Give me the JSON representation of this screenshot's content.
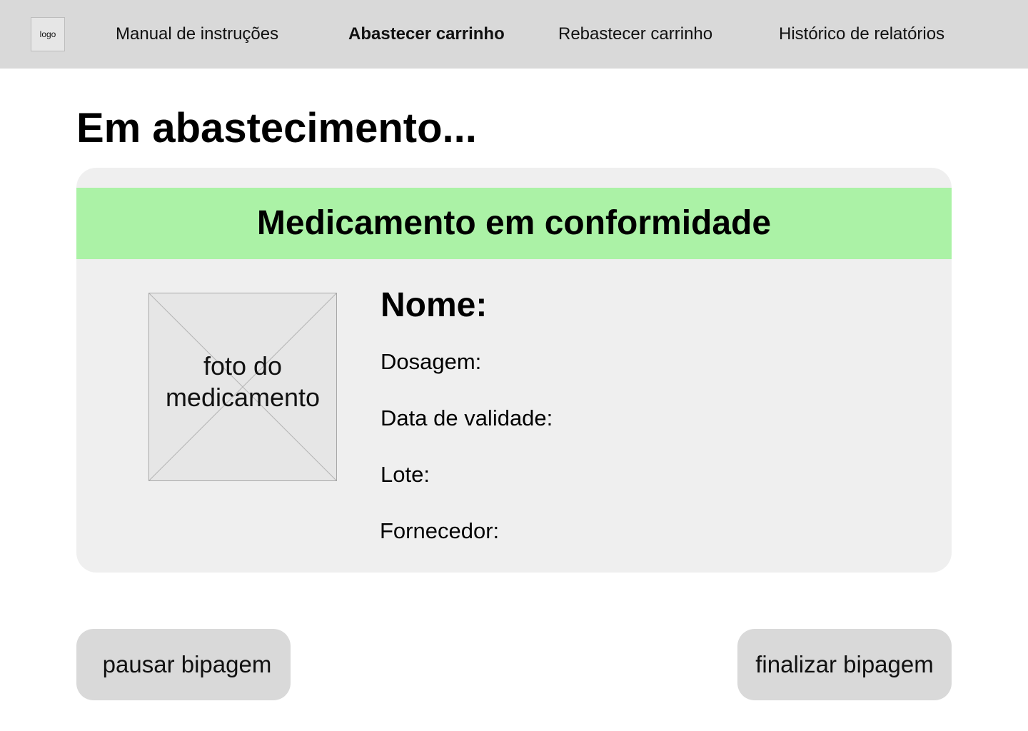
{
  "header": {
    "logo_text": "logo",
    "nav": [
      {
        "label": "Manual de instruções",
        "active": false
      },
      {
        "label": "Abastecer carrinho",
        "active": true
      },
      {
        "label": "Rebastecer carrinho",
        "active": false
      },
      {
        "label": "Histórico de relatórios",
        "active": false
      }
    ]
  },
  "main": {
    "title": "Em abastecimento...",
    "card": {
      "status": "Medicamento em conformidade",
      "status_color": "#abf2a6",
      "photo_placeholder": "foto do medicamento",
      "fields": {
        "name": "Nome:",
        "dosage": "Dosagem:",
        "expiry": "Data de validade:",
        "batch": "Lote:",
        "supplier": "Fornecedor:"
      }
    },
    "actions": {
      "pause": "pausar bipagem",
      "finish": "finalizar bipagem"
    }
  }
}
